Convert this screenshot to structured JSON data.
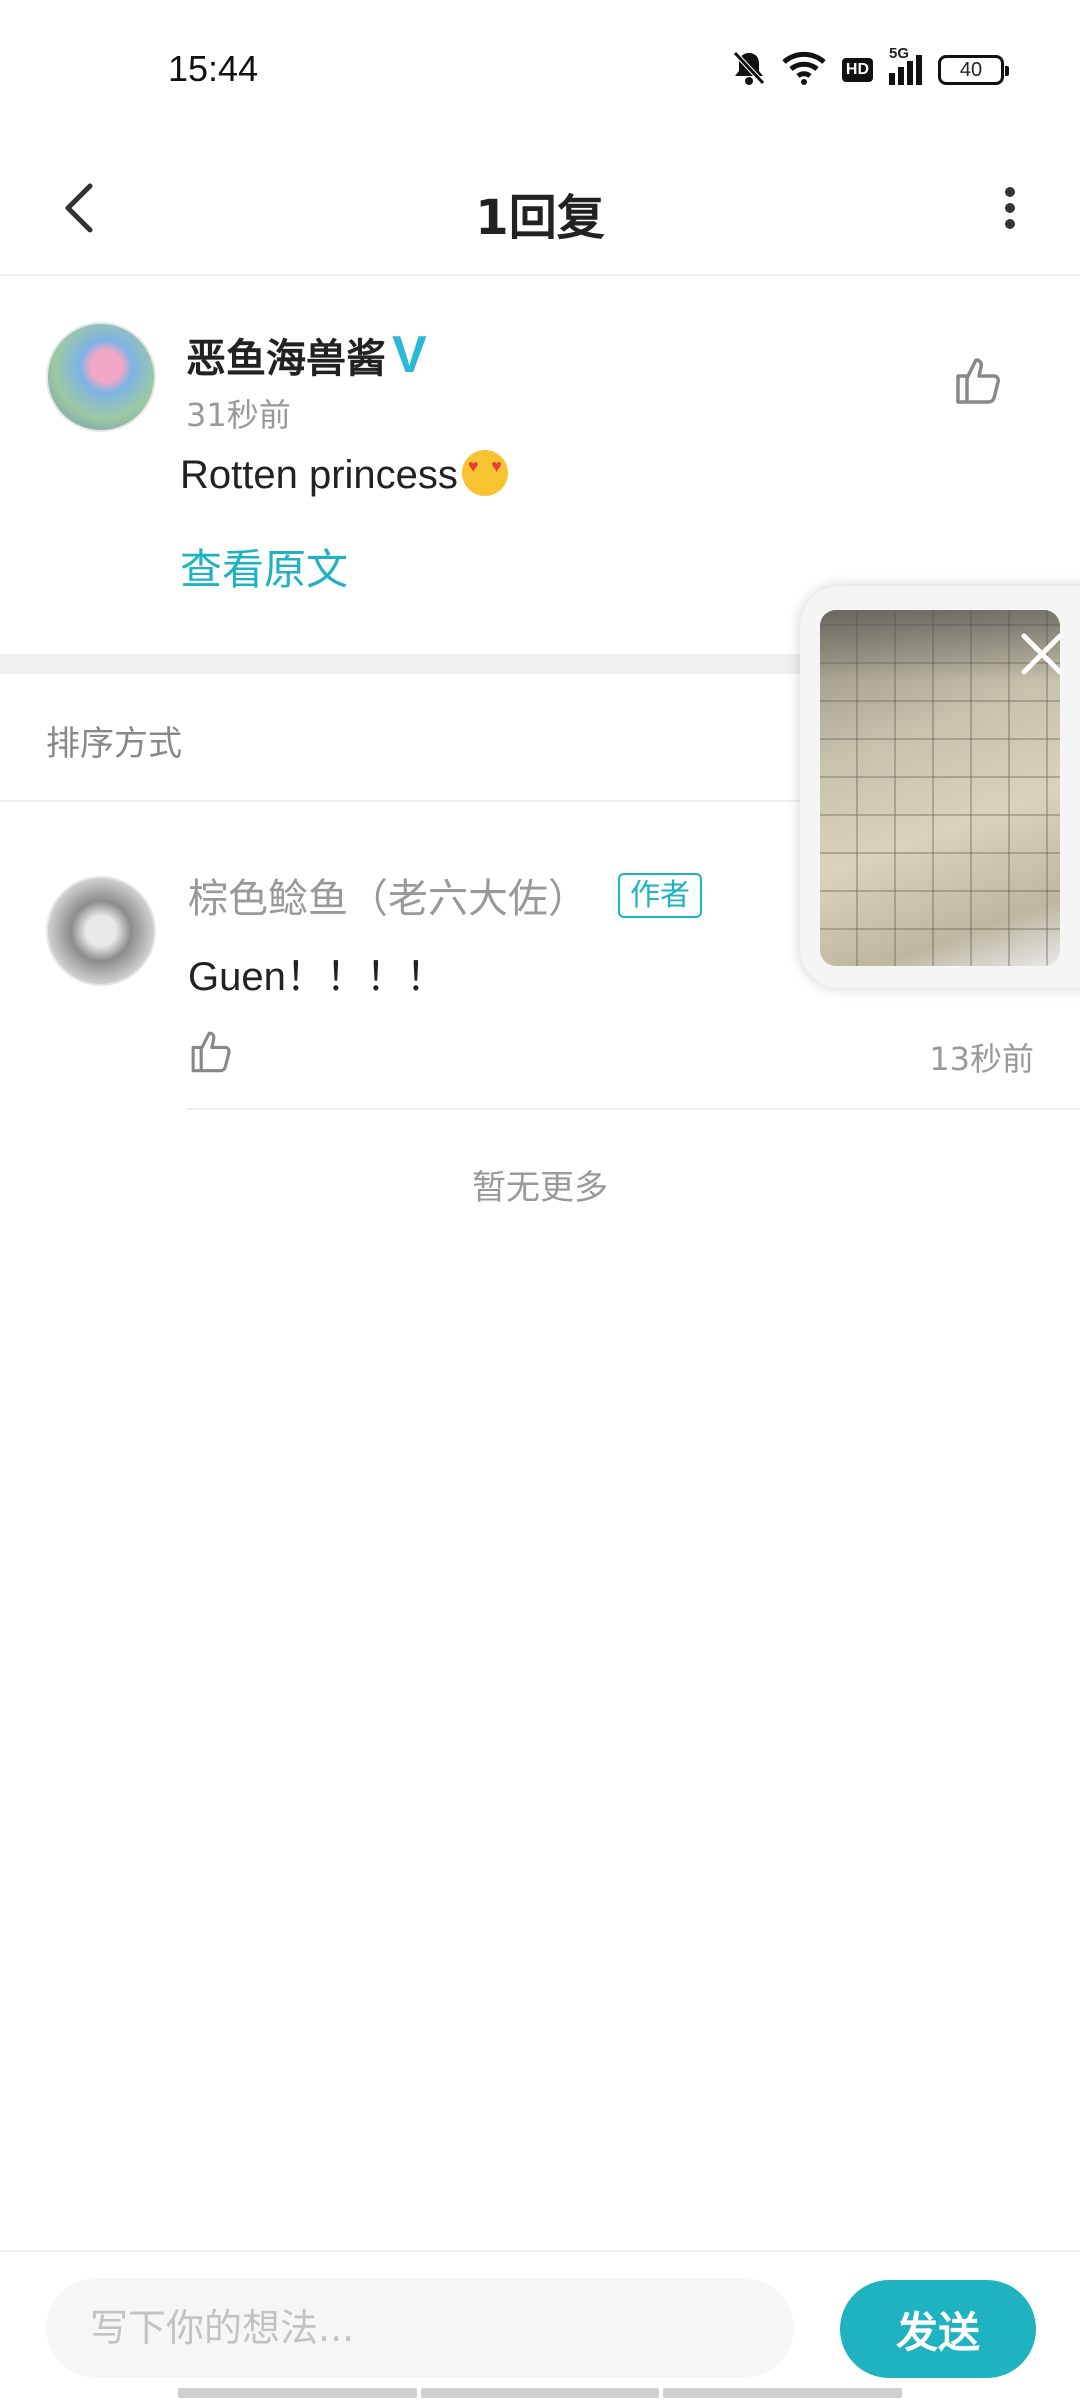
{
  "status_bar": {
    "time": "15:44",
    "battery": "40",
    "hd": "HD",
    "network": "5G",
    "icons": [
      "bell-muted-icon",
      "wifi-icon",
      "hd-icon",
      "signal-icon",
      "battery-icon"
    ]
  },
  "header": {
    "title": "1回复",
    "back_icon": "chevron-left-icon",
    "more_icon": "more-vertical-icon"
  },
  "main_comment": {
    "username": "恶鱼海兽酱",
    "verified_mark": "V",
    "time": "31秒前",
    "text": "Rotten princess",
    "emoji": "heart-eyes-emoji",
    "view_original": "查看原文"
  },
  "sort": {
    "label": "排序方式"
  },
  "reply": {
    "username": "棕色鲶鱼（老六大佐）",
    "author_badge": "作者",
    "text": "Guen！！！！",
    "time": "13秒前"
  },
  "footer_note": "暂无更多",
  "input": {
    "placeholder": "写下你的想法...",
    "value": ""
  },
  "send_label": "发送",
  "colors": {
    "accent": "#1fb3c2",
    "verified": "#2bb7d6",
    "muted_text": "#999999",
    "divider": "#eeeeee"
  }
}
